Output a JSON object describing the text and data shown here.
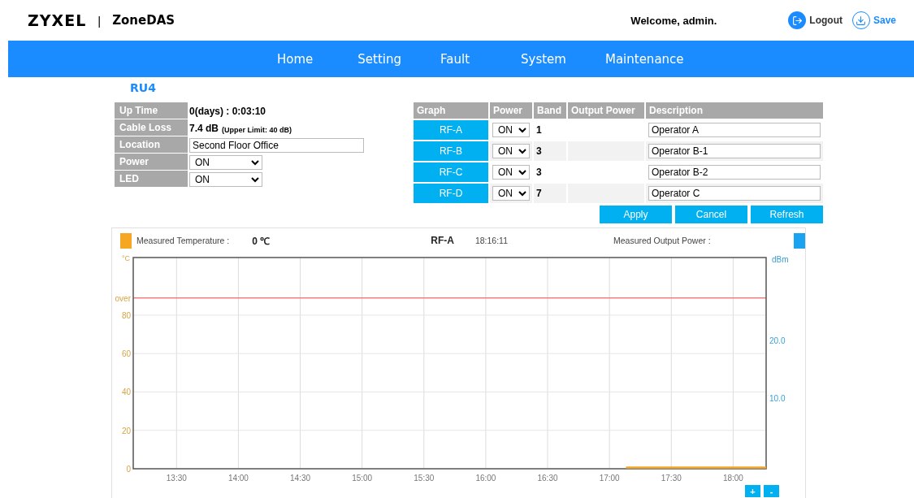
{
  "header": {
    "logo": "ZYXEL",
    "separator": "|",
    "product": "ZoneDAS",
    "welcome": "Welcome, admin.",
    "actions": [
      {
        "kind": "logout",
        "label": "Logout"
      },
      {
        "kind": "save",
        "label": "Save"
      }
    ]
  },
  "nav": [
    {
      "label": "Home"
    },
    {
      "label": "Setting"
    },
    {
      "label": "Fault"
    },
    {
      "label": "System"
    },
    {
      "label": "Maintenance"
    }
  ],
  "unit_title": "RU4",
  "info": [
    {
      "kind": "text",
      "label": "Up Time",
      "value": "0(days) : 0:03:10"
    },
    {
      "kind": "text",
      "label": "Cable Loss",
      "value": "7.4 dB",
      "note": "(Upper Limit: 40 dB)"
    },
    {
      "kind": "input",
      "label": "Location",
      "value": "Second Floor Office"
    },
    {
      "kind": "select",
      "label": "Power",
      "value": "ON"
    },
    {
      "kind": "select",
      "label": "LED",
      "value": "ON"
    }
  ],
  "rf_table": {
    "columns": [
      "Graph",
      "Power",
      "Band",
      "Output Power",
      "Description"
    ],
    "rows": [
      {
        "graph": "RF-A",
        "power": "ON",
        "band": "1",
        "description": "Operator A"
      },
      {
        "graph": "RF-B",
        "power": "ON",
        "band": "3",
        "description": "Operator B-1"
      },
      {
        "graph": "RF-C",
        "power": "ON",
        "band": "3",
        "description": "Operator B-2"
      },
      {
        "graph": "RF-D",
        "power": "ON",
        "band": "7",
        "description": "Operator C"
      }
    ],
    "buttons": [
      "Apply",
      "Cancel",
      "Refresh"
    ]
  },
  "monitor": {
    "legend": [
      {
        "kind": "temperature",
        "label": "Measured Temperature :",
        "value": "0 ℃",
        "color": "#f5a623"
      },
      {
        "kind": "power",
        "label": "Measured Output Power :",
        "color": "#1aa3f0"
      }
    ],
    "channel": "RF-A",
    "time": "18:16:11",
    "left_unit": "°C",
    "right_unit": "dBm",
    "zoom_buttons": [
      "+",
      "-"
    ],
    "chart_data": {
      "type": "line",
      "grid": true,
      "xlim": [
        789,
        1096
      ],
      "ylim": [
        0,
        110
      ],
      "xticks": [
        {
          "value": 810,
          "label": "13:30"
        },
        {
          "value": 840,
          "label": "14:00"
        },
        {
          "value": 870,
          "label": "14:30"
        },
        {
          "value": 900,
          "label": "15:00"
        },
        {
          "value": 930,
          "label": "15:30"
        },
        {
          "value": 960,
          "label": "16:00"
        },
        {
          "value": 990,
          "label": "16:30"
        },
        {
          "value": 1020,
          "label": "17:00"
        },
        {
          "value": 1050,
          "label": "17:30"
        },
        {
          "value": 1080,
          "label": "18:00"
        }
      ],
      "yticks": [
        0,
        20,
        40,
        60,
        80,
        {
          "value": 89,
          "label": "over"
        }
      ],
      "x": [
        1028,
        1096
      ],
      "series": [
        {
          "color": "#f5a623",
          "values": [
            0,
            0
          ]
        }
      ],
      "ref_lines": [
        {
          "value": 89,
          "axis": "y",
          "color": "#f08080"
        }
      ]
    },
    "right_axis_ticks": [
      "20.0",
      "10.0"
    ]
  }
}
